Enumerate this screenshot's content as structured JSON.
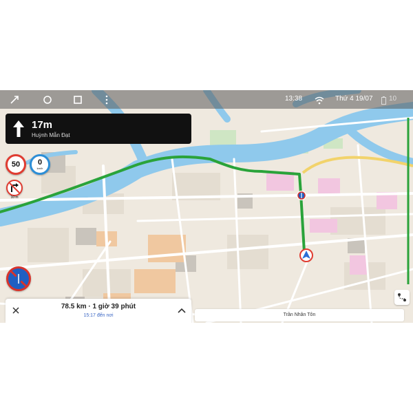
{
  "status_bar": {
    "time": "13:38",
    "date": "Thứ 4 19/07",
    "battery": "10",
    "icons": [
      "back-icon",
      "home-icon",
      "recents-icon",
      "more-icon",
      "wifi-icon",
      "battery-icon"
    ]
  },
  "navigation": {
    "distance": "17m",
    "street": "Huỳnh Mẫn Đạt",
    "maneuver_icon": "straight-arrow-icon"
  },
  "signs": {
    "speed_limit": "50",
    "current_speed": "0",
    "current_speed_unit": "km/h",
    "turn_restriction_distance": "10 m",
    "turn_restriction_icon": "no-right-turn-icon",
    "parking_icon": "no-parking-icon"
  },
  "trip": {
    "summary": "78.5 km · 1 giờ 39 phút",
    "eta": "15:17 đến nơi"
  },
  "map": {
    "current_road": "Trần Nhân Tôn",
    "route_color": "#2aa33a",
    "water_color": "#8fc9ec",
    "land_color": "#efe9df"
  }
}
